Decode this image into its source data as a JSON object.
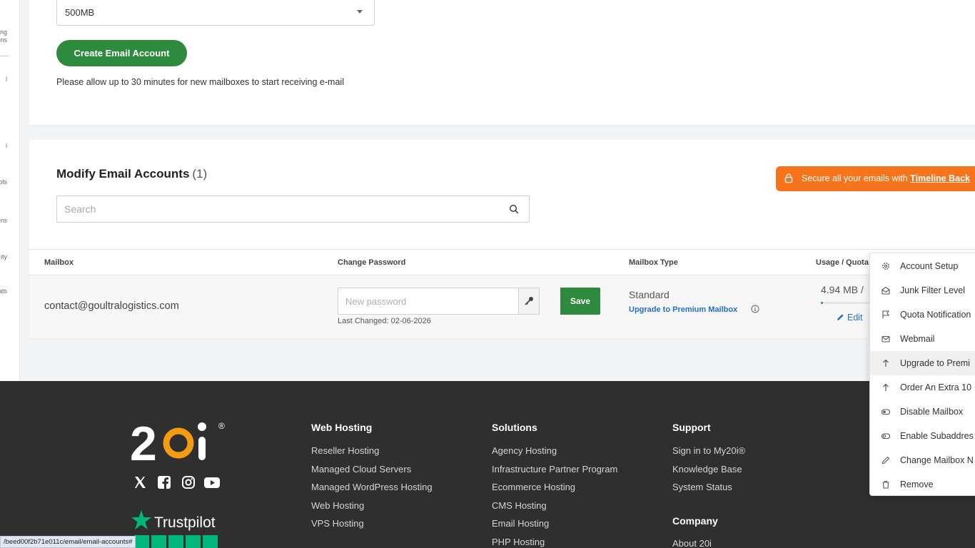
{
  "sidebar": {
    "fragments": [
      "ng",
      "ons",
      "l",
      "i",
      "ols",
      "ons",
      "ity",
      "tats"
    ]
  },
  "create_section": {
    "quota_select_value": "500MB",
    "create_button": "Create Email Account",
    "note": "Please allow up to 30 minutes for new mailboxes to start receiving e-mail"
  },
  "modify_section": {
    "title": "Modify Email Accounts",
    "count": "(1)",
    "search_placeholder": "Search",
    "banner_text": "Secure all your emails with",
    "banner_link": "Timeline Back"
  },
  "table": {
    "headers": [
      "Mailbox",
      "Change Password",
      "Mailbox Type",
      "Usage / Quota"
    ],
    "row": {
      "mailbox": "contact@goultralogistics.com",
      "password_placeholder": "New password",
      "save_label": "Save",
      "last_changed": "Last Changed: 02-06-2026",
      "type": "Standard",
      "upgrade_link": "Upgrade to Premium Mailbox",
      "usage": "4.94 MB /",
      "usage_fraction": 0.01,
      "edit_label": "Edit"
    }
  },
  "menu": {
    "items": [
      {
        "label": "Account Setup",
        "icon": "gear-icon"
      },
      {
        "label": "Junk Filter Level",
        "icon": "envelope-open-icon"
      },
      {
        "label": "Quota Notification",
        "icon": "flag-icon"
      },
      {
        "label": "Webmail",
        "icon": "envelope-icon"
      },
      {
        "label": "Upgrade to Premi",
        "icon": "arrow-up-icon"
      },
      {
        "label": "Order An Extra 10",
        "icon": "arrow-up-icon"
      },
      {
        "label": "Disable Mailbox",
        "icon": "toggle-on-icon"
      },
      {
        "label": "Enable Subaddres",
        "icon": "toggle-off-icon"
      },
      {
        "label": "Change Mailbox N",
        "icon": "pencil-icon"
      },
      {
        "label": "Remove",
        "icon": "trash-icon"
      }
    ]
  },
  "footer": {
    "brand": "20i",
    "trustpilot": "Trustpilot",
    "web_hosting": {
      "heading": "Web Hosting",
      "links": [
        "Reseller Hosting",
        "Managed Cloud Servers",
        "Managed WordPress Hosting",
        "Web Hosting",
        "VPS Hosting"
      ]
    },
    "solutions": {
      "heading": "Solutions",
      "links": [
        "Agency Hosting",
        "Infrastructure Partner Program",
        "Ecommerce Hosting",
        "CMS Hosting",
        "Email Hosting",
        "PHP Hosting"
      ]
    },
    "support": {
      "heading": "Support",
      "links": [
        "Sign in to My20i®",
        "Knowledge Base",
        "System Status"
      ]
    },
    "company": {
      "heading": "Company",
      "links": [
        "About 20i"
      ]
    }
  },
  "status_url": "/beed00f2b71e011c/email/email-accounts#",
  "colors": {
    "primary_green": "#2e8b3e",
    "link_blue": "#1f6fd1",
    "banner_orange": "#f7741d",
    "footer_bg": "#2f2f2f",
    "trustpilot_green": "#00b67a"
  }
}
